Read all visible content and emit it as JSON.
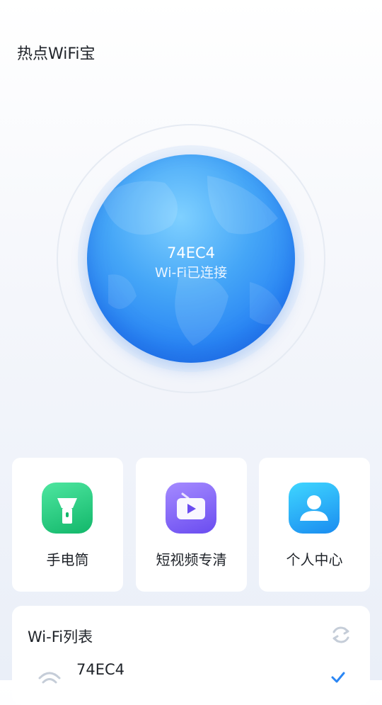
{
  "app": {
    "title": "热点WiFi宝"
  },
  "connection": {
    "ssid": "74EC4",
    "status": "Wi-Fi已连接"
  },
  "quick_actions": [
    {
      "label": "手电筒",
      "icon": "flashlight-icon"
    },
    {
      "label": "短视频专清",
      "icon": "video-clean-icon"
    },
    {
      "label": "个人中心",
      "icon": "profile-icon"
    }
  ],
  "wifi_list": {
    "title": "Wi-Fi列表",
    "items": [
      {
        "ssid": "74EC4",
        "connected": true
      }
    ]
  },
  "colors": {
    "accent": "#2a86f4",
    "green": "#12b76a",
    "purple": "#6a4cf0"
  }
}
